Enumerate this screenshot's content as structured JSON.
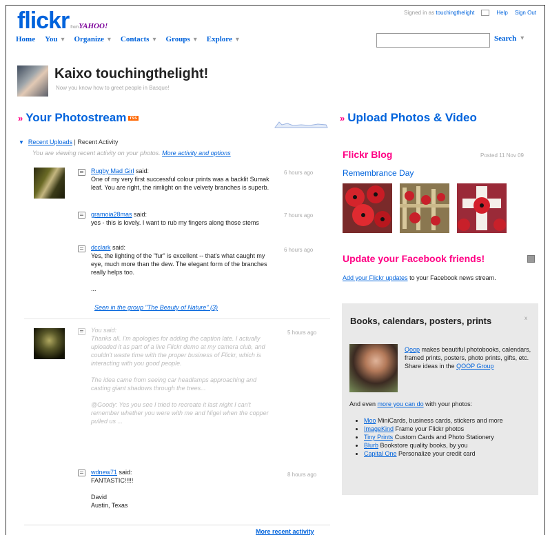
{
  "header": {
    "logo_text": "flickr",
    "logo_from": "from",
    "logo_yahoo": "YAHOO!",
    "signed_in_label": "Signed in as",
    "username": "touchingthelight",
    "help": "Help",
    "sign_out": "Sign Out"
  },
  "nav": {
    "items": [
      "Home",
      "You",
      "Organize",
      "Contacts",
      "Groups",
      "Explore"
    ],
    "search_label": "Search",
    "search_value": ""
  },
  "welcome": {
    "title": "Kaixo touchingthelight!",
    "subtitle": "Now you know how to greet people in Basque!"
  },
  "photostream": {
    "title": "Your Photostream",
    "tab_recent_uploads": "Recent Uploads",
    "tab_separator": "|",
    "tab_recent_activity": "Recent Activity",
    "viewing_note": "You are viewing recent activity on your photos.",
    "more_options": "More activity and options",
    "group1": {
      "c1_author": "Rugby Mad Girl",
      "c1_said": "said:",
      "c1_text": "One of my very first successful colour prints was a backlit Sumak leaf. You are right, the rimlight on the velvety branches is superb.",
      "c1_time": "6 hours ago",
      "c2_author": "gramoia28mas",
      "c2_said": "said:",
      "c2_text": "yes - this is lovely. I want to rub my fingers along those stems",
      "c2_time": "7 hours ago",
      "c3_author": "dcclark",
      "c3_said": "said:",
      "c3_text": "Yes, the lighting of the \"fur\" is excellent -- that's what caught my eye, much more than the dew. The elegant form of the branches really helps too.",
      "c3_ellipsis": "...",
      "c3_time": "6 hours ago",
      "seen_in": "Seen in the group \"The Beauty of Nature\" (3)"
    },
    "group2": {
      "you_said": "You said:",
      "you_text_1": "Thanks all. I'm apologies for adding the caption late. I actually uploaded it as part of a live Flickr demo at my camera club, and couldn't waste time with the proper business of Flickr, which is interacting with you good people.",
      "you_text_2": "The idea came from seeing car headlamps approaching and casting giant shadows through the trees...",
      "you_text_3": "@Goody: Yes you see I tried to recreate it last night I can't remember whether you were with me and Nigel when the copper pulled us ...",
      "you_time": "5 hours ago",
      "c4_author": "wdnew71",
      "c4_said": "said:",
      "c4_text": "FANTASTIC!!!!!",
      "c4_sign1": "David",
      "c4_sign2": "Austin, Texas",
      "c4_time": "8 hours ago"
    },
    "more_recent": "More recent activity"
  },
  "sidebar": {
    "upload_title": "Upload Photos & Video",
    "blog_title": "Flickr Blog",
    "blog_posted": "Posted 11 Nov 09",
    "blog_post_title": "Remembrance Day",
    "fb_title": "Update your Facebook friends!",
    "fb_link": "Add your Flickr updates",
    "fb_text": "to your Facebook news stream.",
    "promo": {
      "title": "Books, calendars, posters, prints",
      "close": "x",
      "qoop_link": "Qoop",
      "qoop_text": "makes beautiful photobooks, calendars, framed prints, posters, photo prints, gifts, etc. Share ideas in the",
      "qoop_group": "QOOP Group",
      "and_even_1": "And even",
      "and_even_link": "more you can do",
      "and_even_2": "with your photos:",
      "list": [
        {
          "link": "Moo",
          "text": "MiniCards, business cards, stickers and more"
        },
        {
          "link": "ImageKind",
          "text": "Frame your Flickr photos"
        },
        {
          "link": "Tiny Prints",
          "text": "Custom Cards and Photo Stationery"
        },
        {
          "link": "Blurb",
          "text": "Bookstore quality books, by you"
        },
        {
          "link": "Capital One",
          "text": "Personalize your credit card"
        }
      ]
    }
  },
  "colors": {
    "link_blue": "#0063dc",
    "flickr_pink": "#ff0084",
    "promo_bg": "#e9e9e9"
  }
}
